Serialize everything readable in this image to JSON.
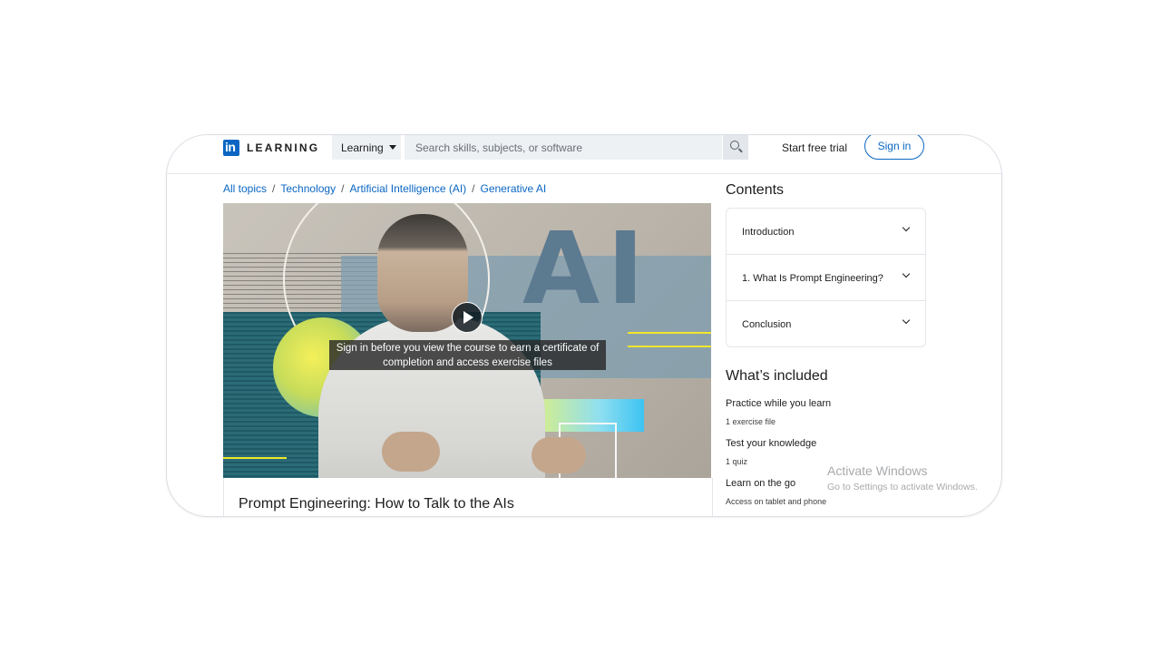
{
  "header": {
    "logo_mark": "in",
    "logo_text": "LEARNING",
    "learning_dropdown": "Learning",
    "search_placeholder": "Search skills, subjects, or software",
    "start_trial": "Start free trial",
    "sign_in": "Sign in"
  },
  "breadcrumb": {
    "items": [
      "All topics",
      "Technology",
      "Artificial Intelligence (AI)",
      "Generative AI"
    ],
    "separator": "/"
  },
  "video": {
    "overlay_line1": "Sign in before you view the course to earn a certificate of",
    "overlay_line2": "completion and access exercise files",
    "ai_graphic_text": "AI"
  },
  "course": {
    "title": "Prompt Engineering: How to Talk to the AIs"
  },
  "contents": {
    "heading": "Contents",
    "sections": [
      "Introduction",
      "1. What Is Prompt Engineering?",
      "Conclusion"
    ]
  },
  "included": {
    "heading": "What’s included",
    "items": [
      {
        "title": "Practice while you learn",
        "subtitle": "1 exercise file"
      },
      {
        "title": "Test your knowledge",
        "subtitle": "1 quiz"
      },
      {
        "title": "Learn on the go",
        "subtitle": "Access on tablet and phone"
      }
    ]
  },
  "watermark": {
    "line1": "Activate Windows",
    "line2": "Go to Settings to activate Windows."
  },
  "colors": {
    "brand": "#0a66c2",
    "text": "#1d1d1d"
  }
}
